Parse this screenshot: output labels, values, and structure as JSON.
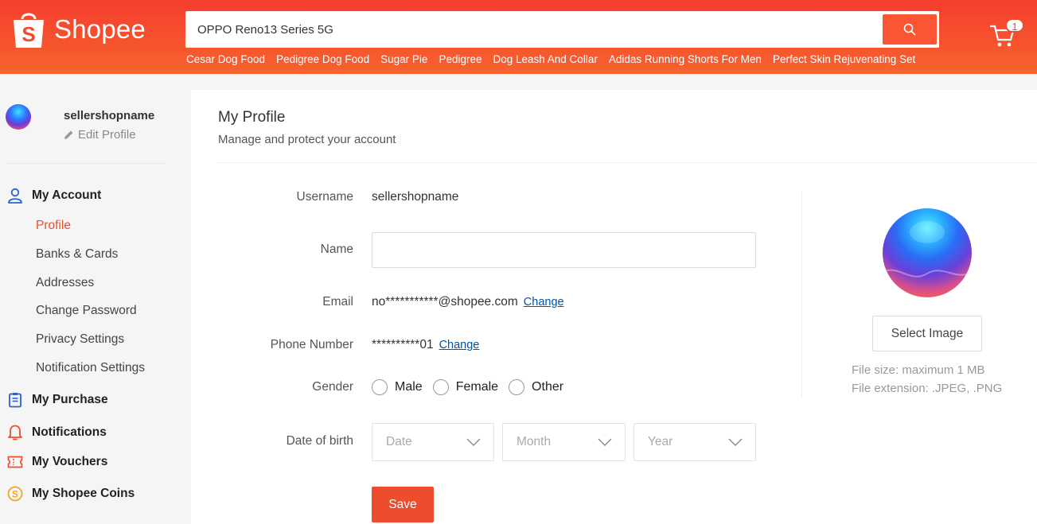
{
  "brand": {
    "name": "Shopee",
    "logo_letter": "S",
    "primary_color": "#ee4d2d"
  },
  "search": {
    "value": "OPPO Reno13 Series 5G",
    "button_icon": "search-icon"
  },
  "suggestions": [
    "Cesar Dog Food",
    "Pedigree Dog Food",
    "Sugar Pie",
    "Pedigree",
    "Dog Leash And Collar",
    "Adidas Running Shorts For Men",
    "Perfect Skin Rejuvenating Set"
  ],
  "cart": {
    "count": "1"
  },
  "sidebar": {
    "username": "sellershopname",
    "edit_label": "Edit Profile",
    "my_account": "My Account",
    "account_items": [
      "Profile",
      "Banks & Cards",
      "Addresses",
      "Change Password",
      "Privacy Settings",
      "Notification Settings"
    ],
    "active_item": "Profile",
    "my_purchase": "My Purchase",
    "notifications": "Notifications",
    "my_vouchers": "My Vouchers",
    "my_coins": "My Shopee Coins"
  },
  "profile": {
    "title": "My Profile",
    "subtitle": "Manage and protect your account",
    "username_label": "Username",
    "username_value": "sellershopname",
    "name_label": "Name",
    "name_value": "",
    "email_label": "Email",
    "email_value": "no***********@shopee.com",
    "email_change": "Change",
    "phone_label": "Phone Number",
    "phone_value": "**********01",
    "phone_change": "Change",
    "gender_label": "Gender",
    "gender_options": [
      "Male",
      "Female",
      "Other"
    ],
    "dob_label": "Date of birth",
    "dob_date": "Date",
    "dob_month": "Month",
    "dob_year": "Year",
    "save_label": "Save"
  },
  "avatar_panel": {
    "select_label": "Select Image",
    "file_size": "File size: maximum 1 MB",
    "file_ext": "File extension: .JPEG, .PNG"
  }
}
